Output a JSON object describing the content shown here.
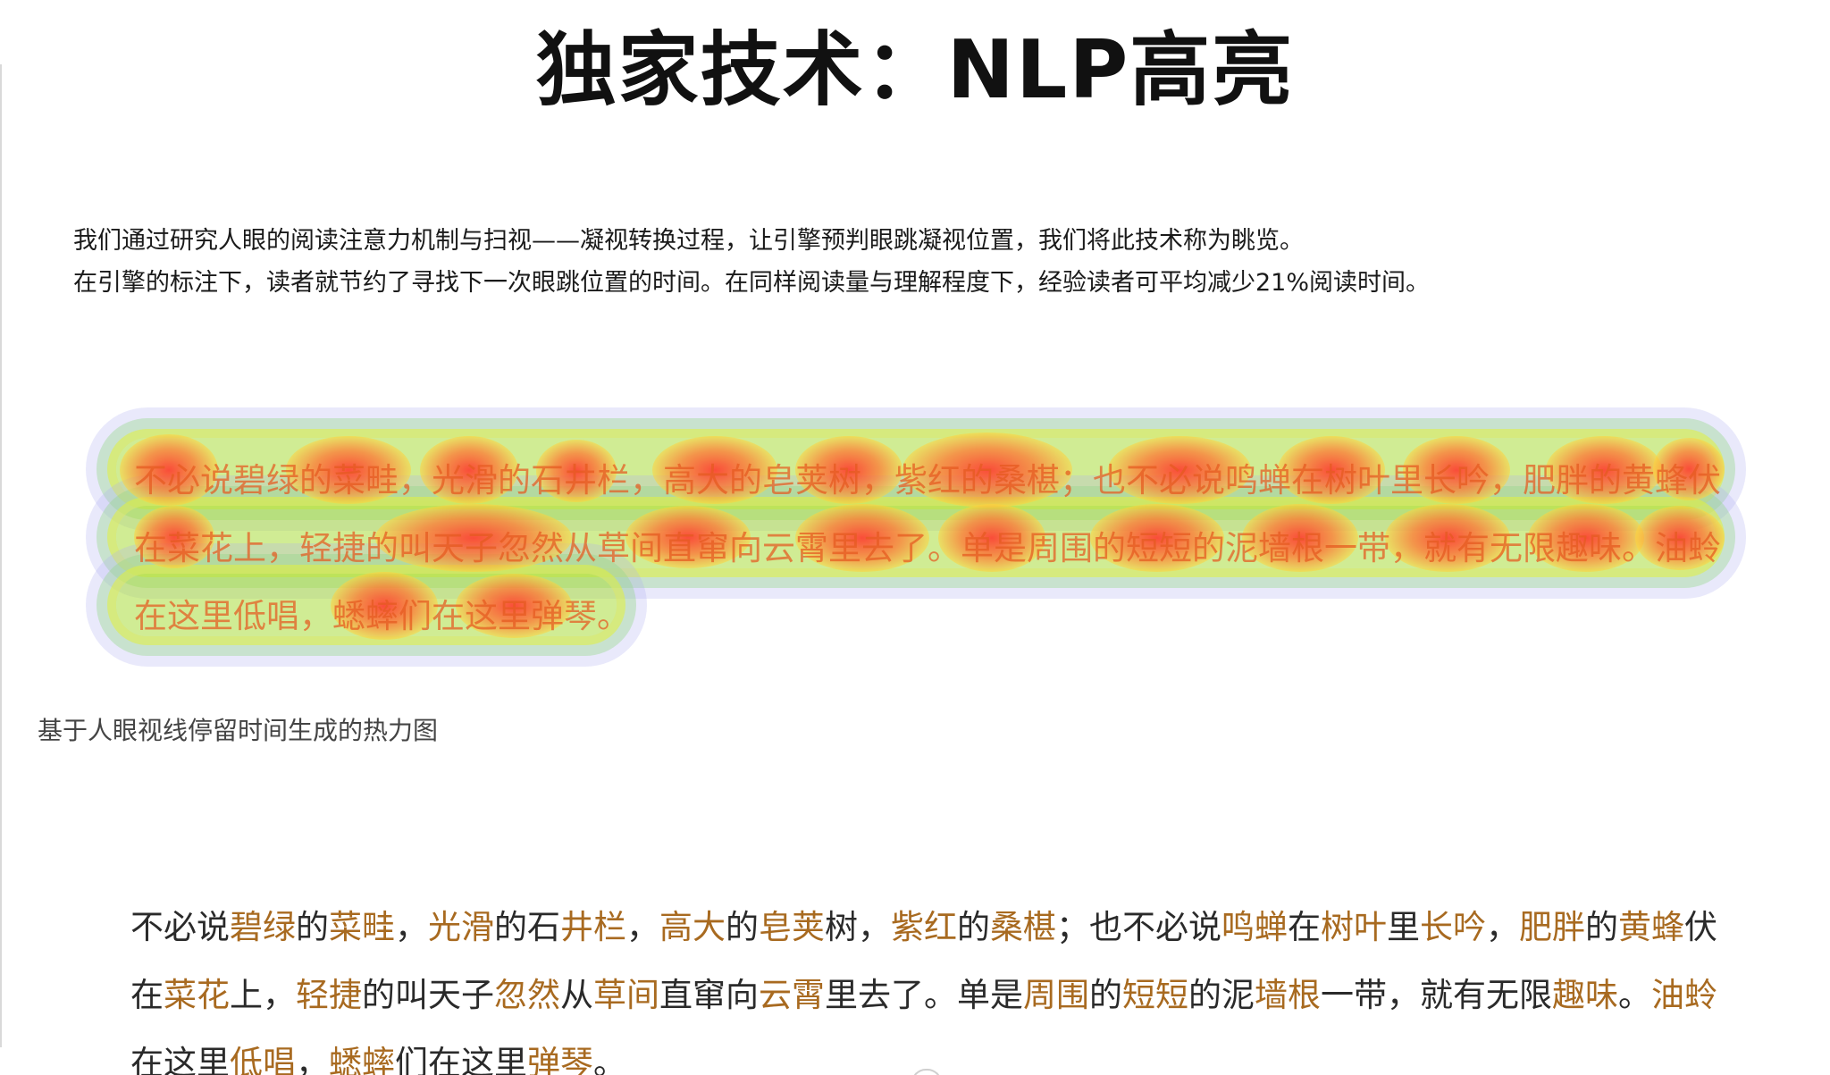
{
  "page": {
    "title": "独家技术：NLP高亮",
    "intro_line1": "我们通过研究人眼的阅读注意力机制与扫视——凝视转换过程，让引擎预判眼跳凝视位置，我们将此技术称为眺览。",
    "intro_line2": "在引擎的标注下，读者就节约了寻找下一次眼跳位置的时间。在同样阅读量与理解程度下，经验读者可平均减少21%阅读时间。",
    "caption": "基于人眼视线停留时间生成的热力图"
  },
  "heatmap_text": {
    "line1": "不必说碧绿的菜畦，光滑的石井栏，高大的皂荚树，紫红的桑椹；也不必说鸣蝉在树叶里长吟，肥胖的黄蜂伏",
    "line2": "在菜花上，轻捷的叫天子忽然从草间直窜向云霄里去了。单是周围的短短的泥墙根一带，就有无限趣味。油蛉",
    "line3": "在这里低唱，蟋蟀们在这里弹琴。"
  },
  "reading_text": {
    "line1": [
      {
        "t": "不必说",
        "h": false
      },
      {
        "t": "碧绿",
        "h": true
      },
      {
        "t": "的",
        "h": false
      },
      {
        "t": "菜畦",
        "h": true
      },
      {
        "t": "，",
        "h": false
      },
      {
        "t": "光滑",
        "h": true
      },
      {
        "t": "的石",
        "h": false
      },
      {
        "t": "井栏",
        "h": true
      },
      {
        "t": "，",
        "h": false
      },
      {
        "t": "高大",
        "h": true
      },
      {
        "t": "的",
        "h": false
      },
      {
        "t": "皂荚",
        "h": true
      },
      {
        "t": "树，",
        "h": false
      },
      {
        "t": "紫红",
        "h": true
      },
      {
        "t": "的",
        "h": false
      },
      {
        "t": "桑椹",
        "h": true
      },
      {
        "t": "；也不必说",
        "h": false
      },
      {
        "t": "鸣蝉",
        "h": true
      },
      {
        "t": "在",
        "h": false
      },
      {
        "t": "树叶",
        "h": true
      },
      {
        "t": "里",
        "h": false
      },
      {
        "t": "长吟",
        "h": true
      },
      {
        "t": "，",
        "h": false
      },
      {
        "t": "肥胖",
        "h": true
      },
      {
        "t": "的",
        "h": false
      },
      {
        "t": "黄蜂",
        "h": true
      },
      {
        "t": "伏",
        "h": false
      }
    ],
    "line2": [
      {
        "t": "在",
        "h": false
      },
      {
        "t": "菜花",
        "h": true
      },
      {
        "t": "上，",
        "h": false
      },
      {
        "t": "轻捷",
        "h": true
      },
      {
        "t": "的叫天子",
        "h": false
      },
      {
        "t": "忽然",
        "h": true
      },
      {
        "t": "从",
        "h": false
      },
      {
        "t": "草间",
        "h": true
      },
      {
        "t": "直窜向",
        "h": false
      },
      {
        "t": "云霄",
        "h": true
      },
      {
        "t": "里去了。单是",
        "h": false
      },
      {
        "t": "周围",
        "h": true
      },
      {
        "t": "的",
        "h": false
      },
      {
        "t": "短短",
        "h": true
      },
      {
        "t": "的泥",
        "h": false
      },
      {
        "t": "墙根",
        "h": true
      },
      {
        "t": "一带，就有无限",
        "h": false
      },
      {
        "t": "趣味",
        "h": true
      },
      {
        "t": "。",
        "h": false
      },
      {
        "t": "油蛉",
        "h": true
      }
    ],
    "line3": [
      {
        "t": "在这里",
        "h": false
      },
      {
        "t": "低唱",
        "h": true
      },
      {
        "t": "，",
        "h": false
      },
      {
        "t": "蟋蟀",
        "h": true
      },
      {
        "t": "们在这里",
        "h": false
      },
      {
        "t": "弹琴",
        "h": true
      },
      {
        "t": "。",
        "h": false
      }
    ]
  },
  "heatmap_palette": {
    "hot": "#ff372d",
    "warm": "#ffd23c",
    "mid": "#aadc3c",
    "cool": "#afafF0"
  },
  "highlight_color": "#a86a20"
}
